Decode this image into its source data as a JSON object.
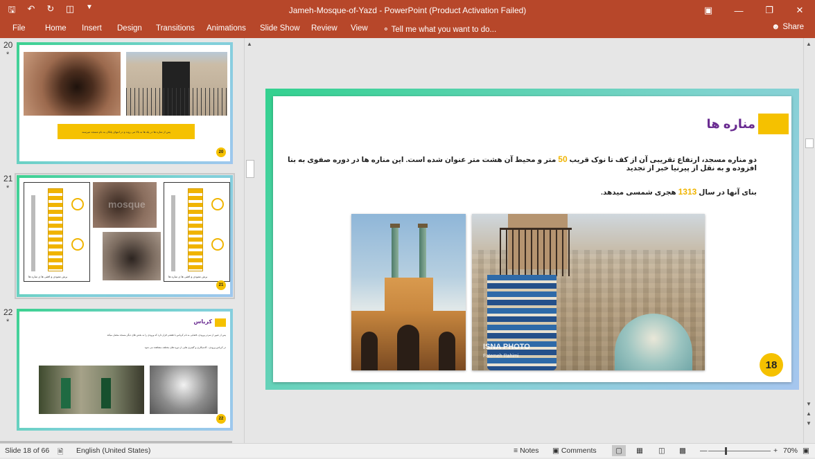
{
  "window": {
    "title": "Jameh-Mosque-of-Yazd  -  PowerPoint (Product Activation Failed)",
    "qat_icons": [
      "save-icon",
      "undo-icon",
      "redo-icon",
      "slideshow-icon",
      "customize-icon"
    ]
  },
  "ribbon": {
    "tabs": [
      "File",
      "Home",
      "Insert",
      "Design",
      "Transitions",
      "Animations",
      "Slide Show",
      "Review",
      "View"
    ],
    "tell_me": "Tell me what you want to do...",
    "share": "Share"
  },
  "thumbnails": [
    {
      "number": "20",
      "star": "*",
      "badge": "20",
      "text_strip": "پس از مناره ها در پله ها به بالا می روند و در انتهای پلکان به بام مسجد میرسند"
    },
    {
      "number": "21",
      "star": "*",
      "badge": "21",
      "watermark": "mosque",
      "caption_a": "برش عمودی و افقی ها ی مناره ها",
      "caption_b": "برش عمودی و افقی ها ی مناره ها"
    },
    {
      "number": "22",
      "star": "*",
      "badge": "22",
      "title": "کریاس",
      "line1": "پس از عبور از سردر ورودی، فضایی به نام کریاس یا هشتی قرار دارد که ورودی را به بخش های دیگر مسجد متصل میکند",
      "line2": "در کریاس ورودی ، کاشیکاری و گچبری هایی از دوره های مختلف مشاهده می شود"
    }
  ],
  "slide": {
    "title": "مناره ها",
    "body_line1_pre": "دو مناره مسجد، ارتفاع تقریبی آن از کف تا نوک قریب ",
    "body_line1_num": "50",
    "body_line1_post": " متر و محیط آن هشت متر عنوان شده است. این مناره ها در دوره صفوی به بنا افزوده و به نقل از پیرنیا خبر از تجدید",
    "body_line2_pre": "بنای آنها در سال ",
    "body_line2_num": "1313",
    "body_line2_post": " هجری شمسی میدهد.",
    "photo_credit": "ISNA PHOTO",
    "photo_author": "Fatemeh Rahimi",
    "badge": "18"
  },
  "status": {
    "slide_info": "Slide 18 of 66",
    "language": "English (United States)",
    "notes": "Notes",
    "comments": "Comments",
    "zoom": "70%"
  }
}
